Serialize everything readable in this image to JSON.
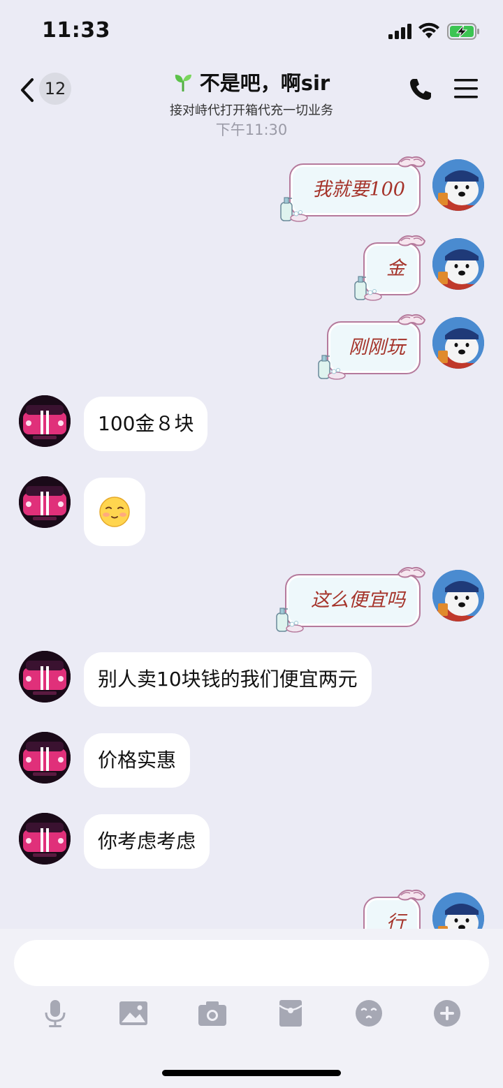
{
  "status_bar": {
    "time": "11:33"
  },
  "header": {
    "unread_count": "12",
    "title": "不是吧，啊sir",
    "subtitle": "接对峙代打开箱代充一切业务"
  },
  "timestamp": "下午11:30",
  "messages": [
    {
      "side": "me",
      "type": "sticker",
      "text": "我就要100"
    },
    {
      "side": "me",
      "type": "sticker",
      "text": "金"
    },
    {
      "side": "me",
      "type": "sticker",
      "text": "刚刚玩"
    },
    {
      "side": "them",
      "type": "text",
      "text": "100金８块"
    },
    {
      "side": "them",
      "type": "emoji",
      "emoji": "smiley-emoji"
    },
    {
      "side": "me",
      "type": "sticker",
      "text": "这么便宜吗"
    },
    {
      "side": "them",
      "type": "text",
      "text": "别人卖10块钱的我们便宜两元"
    },
    {
      "side": "them",
      "type": "text",
      "text": "价格实惠"
    },
    {
      "side": "them",
      "type": "text",
      "text": "你考虑考虑"
    },
    {
      "side": "me",
      "type": "sticker",
      "text": "行"
    }
  ],
  "toolbar": [
    "mic-icon",
    "image-icon",
    "camera-icon",
    "red-packet-icon",
    "emoji-icon",
    "plus-icon"
  ],
  "colors": {
    "background": "#ebebf5",
    "bubble": "#ffffff",
    "sticker_text": "#a5332a",
    "sticker_border": "#b57a9c"
  }
}
